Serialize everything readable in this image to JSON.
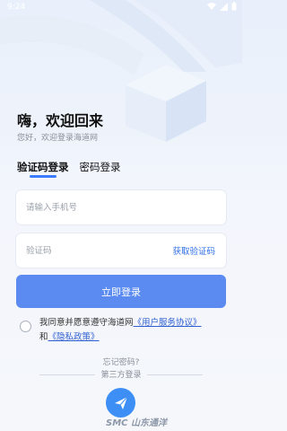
{
  "statusbar": {
    "time": "9:24"
  },
  "header": {
    "greeting": "嗨，欢迎回来",
    "subtitle": "您好，欢迎登录海道网"
  },
  "tabs": [
    {
      "label": "验证码登录",
      "active": true
    },
    {
      "label": "密码登录",
      "active": false
    }
  ],
  "form": {
    "phone_placeholder": "请输入手机号",
    "phone_value": "",
    "code_placeholder": "验证码",
    "code_value": "",
    "get_code_label": "获取验证码",
    "login_label": "立即登录"
  },
  "agreement": {
    "prefix": "我同意并愿意遵守海道网",
    "service_link": "《用户服务协议》",
    "and": "和",
    "privacy_link": "《隐私政策》",
    "checked": false
  },
  "footer": {
    "forgot_label": "忘记密码?",
    "third_party_label": "第三方登录",
    "watermark": "SMC 山东通洋"
  },
  "colors": {
    "accent": "#3a7bff",
    "button": "#5b8bf0",
    "link": "#2f5fd0"
  }
}
